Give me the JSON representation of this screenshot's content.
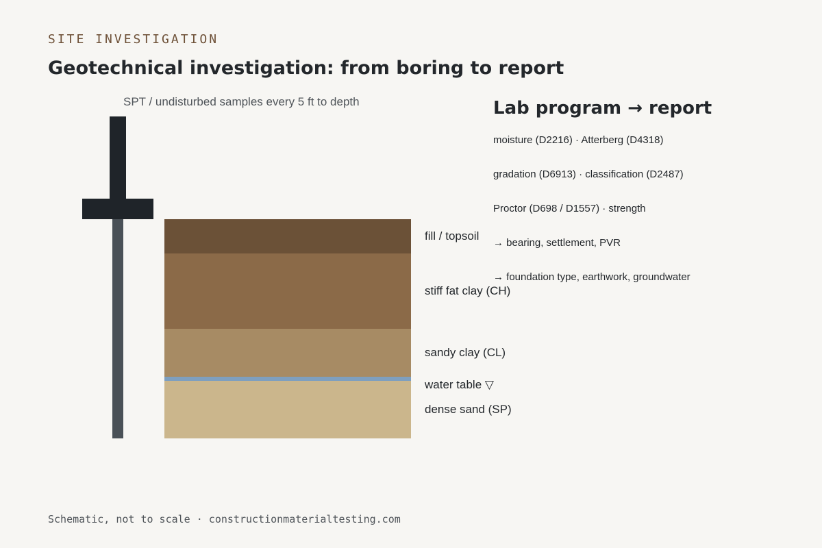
{
  "header": {
    "eyebrow": "SITE INVESTIGATION",
    "title": "Geotechnical investigation: from boring to report"
  },
  "boring": {
    "caption": "SPT / undisturbed samples every 5 ft to depth"
  },
  "layers": {
    "fill": "fill / topsoil",
    "ch": "stiff fat clay (CH)",
    "cl": "sandy clay (CL)",
    "water": "water table ▽",
    "sp": "dense sand (SP)"
  },
  "lab": {
    "title": "Lab program → report",
    "items": [
      "moisture (D2216) · Atterberg (D4318)",
      "gradation (D6913) · classification (D2487)",
      "Proctor (D698 / D1557) · strength",
      "→ bearing, settlement, PVR",
      "→ foundation type, earthwork, groundwater"
    ]
  },
  "footer": {
    "note": "Schematic, not to scale · constructionmaterialtesting.com"
  },
  "colors": {
    "background": "#f7f6f3",
    "fill_topsoil": "#6b5137",
    "fat_clay": "#8b6a48",
    "sandy_clay": "#a78b64",
    "water_table": "#7e9fbf",
    "dense_sand": "#cbb68c",
    "rig": "#1f2429"
  }
}
